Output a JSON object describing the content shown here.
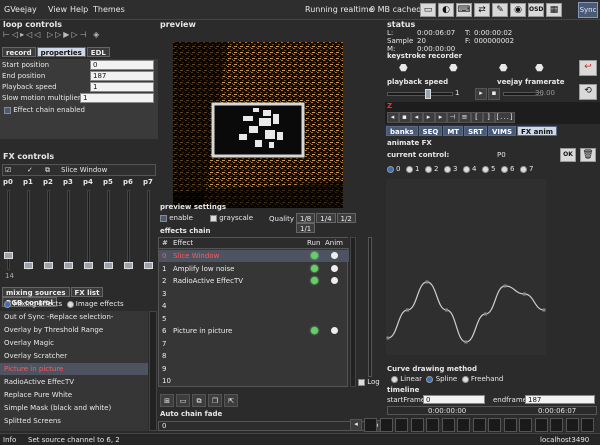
{
  "menubar": {
    "app": "GVeejay",
    "items": [
      "View",
      "Help",
      "Themes"
    ],
    "status": "Running realtime",
    "cache": "0 MB cached",
    "sync_label": "Sync"
  },
  "loop_controls": {
    "title": "loop controls",
    "tabs": [
      "record",
      "properties",
      "EDL"
    ],
    "fields": [
      {
        "label": "Start position",
        "value": "0"
      },
      {
        "label": "End position",
        "value": "187"
      },
      {
        "label": "Playback speed",
        "value": "1"
      },
      {
        "label": "Slow motion multiplier",
        "value": "1"
      }
    ],
    "effect_chain_label": "Effect chain enabled"
  },
  "fx_controls": {
    "title": "FX controls",
    "slice_label": "Slice Window",
    "params": [
      "p0",
      "p1",
      "p2",
      "p3",
      "p4",
      "p5",
      "p6",
      "p7"
    ],
    "value": "14"
  },
  "mixing": {
    "tabs": [
      "mixing sources",
      "FX list",
      "RGB control"
    ],
    "radio": [
      "Mixing effects",
      "Image effects"
    ],
    "items": [
      "Out of Sync -Replace selection-",
      "Overlay by Threshold Range",
      "Overlay Magic",
      "Overlay Scratcher",
      "Picture in picture",
      "RadioActive EffecTV",
      "Replace Pure White",
      "Simple Mask (black and white)",
      "Splitted Screens"
    ],
    "selected_index": 4
  },
  "preview": {
    "title": "preview",
    "settings_title": "preview settings",
    "enable": "enable",
    "grayscale": "grayscale",
    "quality_label": "Quality",
    "quality_options": [
      "1/8",
      "1/4",
      "1/2",
      "1/1"
    ]
  },
  "effects_chain": {
    "title": "effects chain",
    "col_num": "#",
    "col_effect": "Effect",
    "col_run": "Run",
    "col_anim": "Anim",
    "rows": [
      {
        "n": "0",
        "effect": "Slice Window",
        "run": true,
        "anim": true
      },
      {
        "n": "1",
        "effect": "Amplify low noise",
        "run": true,
        "anim": true
      },
      {
        "n": "2",
        "effect": "RadioActive EffecTV",
        "run": true,
        "anim": true
      },
      {
        "n": "3",
        "effect": "",
        "run": false,
        "anim": false
      },
      {
        "n": "4",
        "effect": "",
        "run": false,
        "anim": false
      },
      {
        "n": "5",
        "effect": "",
        "run": false,
        "anim": false
      },
      {
        "n": "6",
        "effect": "Picture in picture",
        "run": true,
        "anim": true
      },
      {
        "n": "7",
        "effect": "",
        "run": false,
        "anim": false
      },
      {
        "n": "8",
        "effect": "",
        "run": false,
        "anim": false
      },
      {
        "n": "9",
        "effect": "",
        "run": false,
        "anim": false
      },
      {
        "n": "10",
        "effect": "",
        "run": false,
        "anim": false
      }
    ],
    "log_label": "Log",
    "auto_chain_fade": "Auto chain fade",
    "fade_value": "0"
  },
  "status": {
    "title": "status",
    "L_label": "L:",
    "L": "0:00:06:07",
    "T_label": "T:",
    "T": "0:00:00:02",
    "sample_label": "Sample",
    "sample": "20",
    "F_label": "F:",
    "F": "000000002",
    "M_label": "M:",
    "M": "0:00:00:00"
  },
  "keystroke": {
    "title": "keystroke recorder"
  },
  "speed": {
    "playback_title": "playback speed",
    "playback_value": "1",
    "framerate_title": "veejay framerate",
    "framerate_value": "30.00"
  },
  "right_tabs": [
    "banks",
    "SEQ",
    "MT",
    "SRT",
    "VIMS",
    "FX anim"
  ],
  "animate": {
    "title": "animate FX",
    "control_label": "current control:",
    "control_value": "P0",
    "channels": [
      "0",
      "1",
      "2",
      "3",
      "4",
      "5",
      "6",
      "7"
    ],
    "curve_values": [
      0.2,
      0.55,
      0.9,
      0.55,
      0.15,
      0.5,
      0.85,
      0.75,
      0.55
    ]
  },
  "curve": {
    "title": "Curve drawing method",
    "options": [
      "Linear",
      "Spline",
      "Freehand"
    ],
    "selected": "Spline"
  },
  "timeline": {
    "title": "timeline",
    "start_label": "startFrame",
    "start_value": "0",
    "end_label": "endframe",
    "end_value": "187",
    "time_start": "0:00:00:00",
    "time_end": "0:00:06:07"
  },
  "statusbar": {
    "info_label": "Info",
    "message": "Set source channel to 6, 2",
    "host": "localhost3490"
  },
  "colors": {
    "accent_blue": "#475a78",
    "highlight_red": "#ff5a5a",
    "run_green": "#62d062"
  }
}
